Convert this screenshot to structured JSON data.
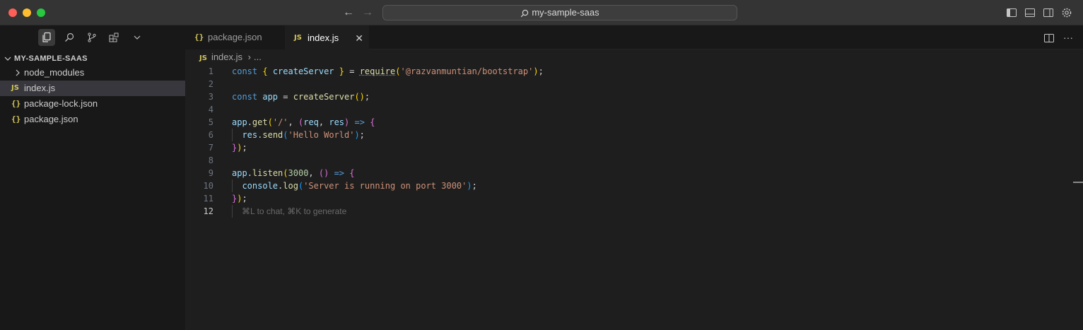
{
  "window": {
    "search_text": "my-sample-saas"
  },
  "sidebar": {
    "title": "MY-SAMPLE-SAAS",
    "items": [
      {
        "label": "node_modules",
        "type": "folder",
        "icon": "chevron-right-icon"
      },
      {
        "label": "index.js",
        "type": "js",
        "icon_text": "JS",
        "active": true
      },
      {
        "label": "package-lock.json",
        "type": "json",
        "icon_text": "{}"
      },
      {
        "label": "package.json",
        "type": "json",
        "icon_text": "{}"
      }
    ]
  },
  "tabs": [
    {
      "label": "package.json",
      "icon_text": "{}",
      "active": false
    },
    {
      "label": "index.js",
      "icon_text": "JS",
      "active": true
    }
  ],
  "breadcrumb": {
    "icon_text": "JS",
    "file": "index.js",
    "more": "..."
  },
  "editor": {
    "line_numbers": [
      "1",
      "2",
      "3",
      "4",
      "5",
      "6",
      "7",
      "8",
      "9",
      "10",
      "11",
      "12"
    ],
    "hint": "⌘L to chat, ⌘K to generate",
    "lines": [
      "const { createServer } = require('@razvanmuntian/bootstrap');",
      "",
      "const app = createServer();",
      "",
      "app.get('/', (req, res) => {",
      "  res.send('Hello World');",
      "});",
      "",
      "app.listen(3000, () => {",
      "  console.log('Server is running on port 3000');",
      "});",
      ""
    ]
  },
  "colors": {
    "keyword": "#569cd6",
    "function": "#dcdcaa",
    "string": "#ce9178",
    "number": "#b5cea8",
    "variable": "#9cdcfe"
  }
}
